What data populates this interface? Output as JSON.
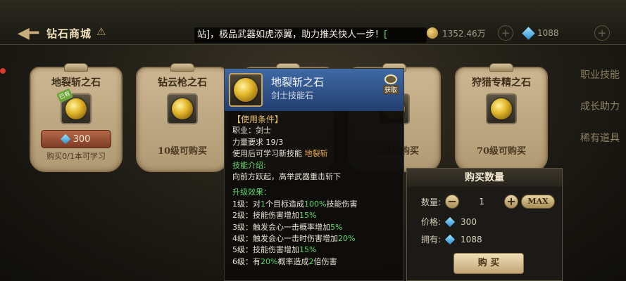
{
  "header": {
    "title": "钻石商城",
    "marquee_prefix": "站]，极品武器如虎添翼，助力推关快人一步！",
    "marquee_suffix": "[",
    "gold_amount": "1352.46万",
    "diamond_amount": "1088"
  },
  "cards": [
    {
      "name": "地裂斩之石",
      "price": "300",
      "note": "购买0/1本可学习",
      "owned_tag": "已有"
    },
    {
      "name": "钻云枪之石",
      "requirement": "10级可购买"
    },
    {
      "name": "",
      "requirement": ""
    },
    {
      "name": "",
      "requirement": "50级可购买"
    },
    {
      "name": "狩猎专精之石",
      "requirement": "70级可购买"
    }
  ],
  "side_tabs": [
    "职业技能",
    "成长助力",
    "稀有道具"
  ],
  "tooltip": {
    "name": "地裂斩之石",
    "type": "剑士技能石",
    "get_label": "获取",
    "conditions_header": "【使用条件】",
    "profession": "职业：剑士",
    "strength_req": "力量要求 19/3",
    "learn_prefix": "使用后可学习新技能 ",
    "learn_skill": "地裂斩",
    "intro_header": "技能介绍:",
    "intro_text": "向前方跃起，高举武器重击斩下",
    "upgrade_header": "升级效果：",
    "levels": [
      {
        "a": "1级：对",
        "g1": "1",
        "b": "个目标造成",
        "g2": "100%",
        "c": "技能伤害"
      },
      {
        "a": "2级：技能伤害增加",
        "g1": "15%",
        "b": "",
        "g2": "",
        "c": ""
      },
      {
        "a": "3级：触发会心一击概率增加",
        "g1": "5%",
        "b": "",
        "g2": "",
        "c": ""
      },
      {
        "a": "4级：触发会心一击时伤害增加",
        "g1": "20%",
        "b": "",
        "g2": "",
        "c": ""
      },
      {
        "a": "5级：技能伤害增加",
        "g1": "15%",
        "b": "",
        "g2": "",
        "c": ""
      },
      {
        "a": "6级：有",
        "g1": "20%",
        "b": "概率造成",
        "g2": "2",
        "c": "倍伤害"
      }
    ]
  },
  "buy_panel": {
    "title": "购买数量",
    "qty_label": "数量:",
    "qty_value": "1",
    "minus": "−",
    "plus": "+",
    "max_label": "MAX",
    "price_label": "价格:",
    "price_value": "300",
    "owned_label": "拥有:",
    "owned_value": "1088",
    "buy_label": "购 买"
  }
}
